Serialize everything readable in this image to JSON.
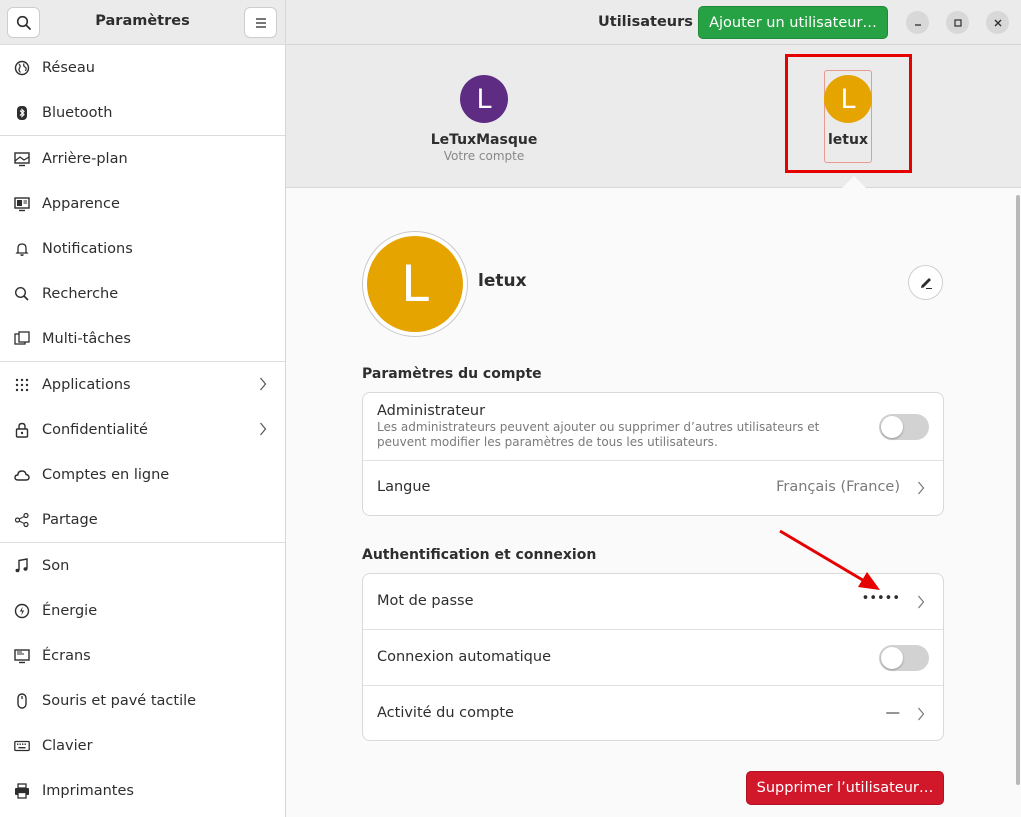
{
  "sidebar": {
    "title": "Paramètres",
    "items": [
      {
        "label": "Réseau",
        "icon": "network-icon"
      },
      {
        "label": "Bluetooth",
        "icon": "bluetooth-icon"
      },
      {
        "label": "Arrière-plan",
        "icon": "background-icon"
      },
      {
        "label": "Apparence",
        "icon": "appearance-icon"
      },
      {
        "label": "Notifications",
        "icon": "bell-icon"
      },
      {
        "label": "Recherche",
        "icon": "search-icon"
      },
      {
        "label": "Multi-tâches",
        "icon": "multitasking-icon"
      },
      {
        "label": "Applications",
        "icon": "grid-icon",
        "has_chevron": true
      },
      {
        "label": "Confidentialité",
        "icon": "lock-icon",
        "has_chevron": true
      },
      {
        "label": "Comptes en ligne",
        "icon": "cloud-icon"
      },
      {
        "label": "Partage",
        "icon": "share-icon"
      },
      {
        "label": "Son",
        "icon": "music-note-icon"
      },
      {
        "label": "Énergie",
        "icon": "power-icon"
      },
      {
        "label": "Écrans",
        "icon": "display-icon"
      },
      {
        "label": "Souris et pavé tactile",
        "icon": "mouse-icon"
      },
      {
        "label": "Clavier",
        "icon": "keyboard-icon"
      },
      {
        "label": "Imprimantes",
        "icon": "printer-icon"
      }
    ]
  },
  "header": {
    "title": "Utilisateurs",
    "add_user_label": "Ajouter un utilisateur…"
  },
  "users": [
    {
      "initial": "L",
      "name": "LeTuxMasque",
      "subtitle": "Votre compte",
      "color": "#5e2c83"
    },
    {
      "initial": "L",
      "name": "letux",
      "subtitle": "",
      "color": "#e6a400",
      "selected": true
    }
  ],
  "profile": {
    "initial": "L",
    "name": "letux",
    "color": "#e6a400"
  },
  "account_settings": {
    "title": "Paramètres du compte",
    "admin_label": "Administrateur",
    "admin_desc": "Les administrateurs peuvent ajouter ou supprimer d’autres utilisateurs et peuvent modifier les paramètres de tous les utilisateurs.",
    "admin_enabled": false,
    "language_label": "Langue",
    "language_value": "Français (France)"
  },
  "auth": {
    "title": "Authentification et connexion",
    "password_label": "Mot de passe",
    "password_value": "•••••",
    "autologin_label": "Connexion automatique",
    "autologin_enabled": false,
    "activity_label": "Activité du compte",
    "activity_value": "—"
  },
  "delete_label": "Supprimer l’utilisateur…",
  "colors": {
    "accent_green": "#26a244",
    "destructive_red": "#d1172a",
    "annotation_red": "#e60000"
  }
}
